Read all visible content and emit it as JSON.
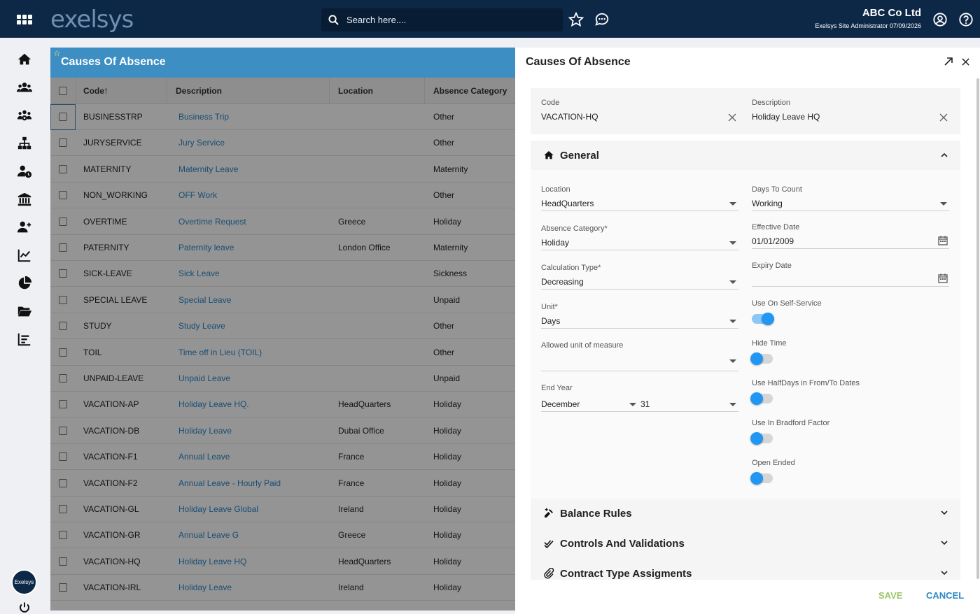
{
  "topbar": {
    "logo": "exelsys",
    "search_placeholder": "Search here....",
    "company_name": "ABC Co Ltd",
    "user_line": "Exelsys Site Administrator 07/09/2026"
  },
  "sidebar": {
    "items": [
      "home-icon",
      "people-icon",
      "group-settings-icon",
      "org-chart-icon",
      "user-clock-icon",
      "bank-icon",
      "user-add-icon",
      "line-chart-icon",
      "pie-chart-icon",
      "folder-open-icon",
      "bar-list-icon"
    ],
    "avatar_text": "Exelsys"
  },
  "table": {
    "title": "Causes Of Absence",
    "columns": [
      "Code",
      "Description",
      "Location",
      "Absence Category"
    ],
    "rows": [
      {
        "code": "BUSINESSTRP",
        "description": "Business Trip",
        "location": "",
        "category": "Other"
      },
      {
        "code": "JURYSERVICE",
        "description": "Jury Service",
        "location": "",
        "category": "Other"
      },
      {
        "code": "MATERNITY",
        "description": "Maternity Leave",
        "location": "",
        "category": "Maternity"
      },
      {
        "code": "NON_WORKING",
        "description": "OFF Work",
        "location": "",
        "category": "Other"
      },
      {
        "code": "OVERTIME",
        "description": "Overtime Request",
        "location": "Greece",
        "category": "Holiday"
      },
      {
        "code": "PATERNITY",
        "description": "Paternity leave",
        "location": "London Office",
        "category": "Maternity"
      },
      {
        "code": "SICK-LEAVE",
        "description": "Sick Leave",
        "location": "",
        "category": "Sickness"
      },
      {
        "code": "SPECIAL LEAVE",
        "description": "Special Leave",
        "location": "",
        "category": "Unpaid"
      },
      {
        "code": "STUDY",
        "description": "Study Leave",
        "location": "",
        "category": "Other"
      },
      {
        "code": "TOIL",
        "description": "Time off in Lieu (TOIL)",
        "location": "",
        "category": "Other"
      },
      {
        "code": "UNPAID-LEAVE",
        "description": "Unpaid Leave",
        "location": "",
        "category": "Unpaid"
      },
      {
        "code": "VACATION-AP",
        "description": "Holiday Leave HQ.",
        "location": "HeadQuarters",
        "category": "Holiday"
      },
      {
        "code": "VACATION-DB",
        "description": "Holiday Leave",
        "location": "Dubai Office",
        "category": "Holiday"
      },
      {
        "code": "VACATION-F1",
        "description": "Annual Leave",
        "location": "France",
        "category": "Holiday"
      },
      {
        "code": "VACATION-F2",
        "description": "Annual Leave - Hourly Paid",
        "location": "France",
        "category": "Holiday"
      },
      {
        "code": "VACATION-GL",
        "description": "Holiday Leave Global",
        "location": "Ireland",
        "category": "Holiday"
      },
      {
        "code": "VACATION-GR",
        "description": "Annual Leave G",
        "location": "Greece",
        "category": "Holiday"
      },
      {
        "code": "VACATION-HQ",
        "description": "Holiday Leave HQ",
        "location": "HeadQuarters",
        "category": "Holiday"
      },
      {
        "code": "VACATION-IRL",
        "description": "Holiday Leave",
        "location": "Ireland",
        "category": "Holiday"
      }
    ]
  },
  "detail": {
    "title": "Causes Of Absence",
    "code_label": "Code",
    "code_value": "VACATION-HQ",
    "description_label": "Description",
    "description_value": "Holiday Leave HQ",
    "general_title": "General",
    "location_label": "Location",
    "location_value": "HeadQuarters",
    "days_to_count_label": "Days To Count",
    "days_to_count_value": "Working",
    "absence_category_label": "Absence Category*",
    "absence_category_value": "Holiday",
    "effective_date_label": "Effective Date",
    "effective_date_value": "01/01/2009",
    "calculation_type_label": "Calculation Type*",
    "calculation_type_value": "Decreasing",
    "expiry_date_label": "Expiry Date",
    "unit_label": "Unit*",
    "unit_value": "Days",
    "use_self_service_label": "Use On Self-Service",
    "allowed_unit_label": "Allowed unit of measure",
    "hide_time_label": "Hide Time",
    "end_year_label": "End Year",
    "end_year_month": "December",
    "end_year_day": "31",
    "use_halfdays_label": "Use HalfDays in From/To Dates",
    "use_bradford_label": "Use In Bradford Factor",
    "open_ended_label": "Open Ended",
    "balance_rules_title": "Balance Rules",
    "controls_title": "Controls And Validations",
    "contract_title": "Contract Type Assigments",
    "save_label": "SAVE",
    "cancel_label": "CANCEL"
  }
}
